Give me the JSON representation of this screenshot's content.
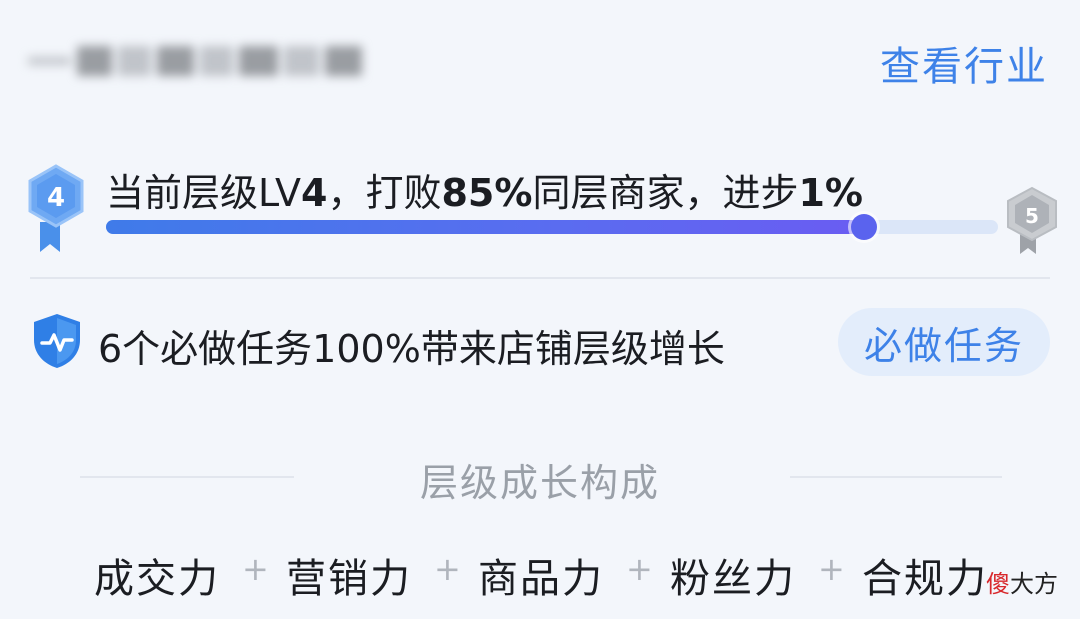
{
  "header": {
    "store_name_blurred": true,
    "industry_link": "查看行业"
  },
  "level": {
    "current_level_badge": "4",
    "next_level_badge": "5",
    "text_prefix": "当前层级LV",
    "text_level": "4",
    "text_mid1": "，打败",
    "text_beat_pct": "85%",
    "text_mid2": "同层商家，进步",
    "text_progress_pct": "1%",
    "progress_fraction": 0.85,
    "colors": {
      "progress": "#4f72ee",
      "badge_current": "#5b9bf0",
      "badge_next": "#a9adb3"
    }
  },
  "tasks": {
    "icon": "shield-pulse-icon",
    "text": "6个必做任务100%带来店铺层级增长",
    "button_label": "必做任务",
    "accent_color": "#3e82e8"
  },
  "growth": {
    "section_title": "层级成长构成",
    "factors": [
      "成交力",
      "营销力",
      "商品力",
      "粉丝力",
      "合规力"
    ],
    "separator": "+"
  },
  "watermark": {
    "part1": "傻",
    "part2": "大方"
  }
}
